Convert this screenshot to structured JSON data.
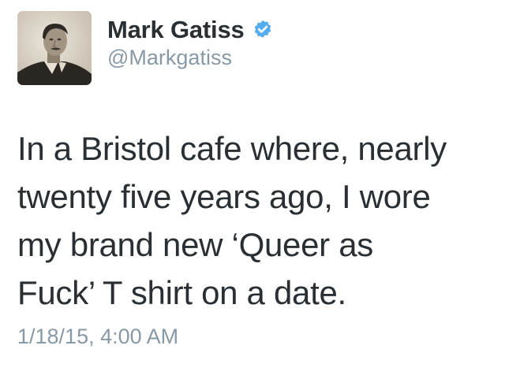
{
  "author": {
    "display_name": "Mark Gatiss",
    "handle": "@Markgatiss",
    "verified": true,
    "verified_icon": "verified-badge-icon",
    "verified_color": "#55acee"
  },
  "tweet": {
    "lines": [
      "In a Bristol cafe where, nearly",
      "twenty five years ago, I wore",
      "my brand new ‘Queer as",
      "Fuck’ T shirt on a date."
    ],
    "timestamp": "1/18/15, 4:00 AM"
  },
  "colors": {
    "text": "#292f33",
    "secondary": "#8899a6"
  }
}
